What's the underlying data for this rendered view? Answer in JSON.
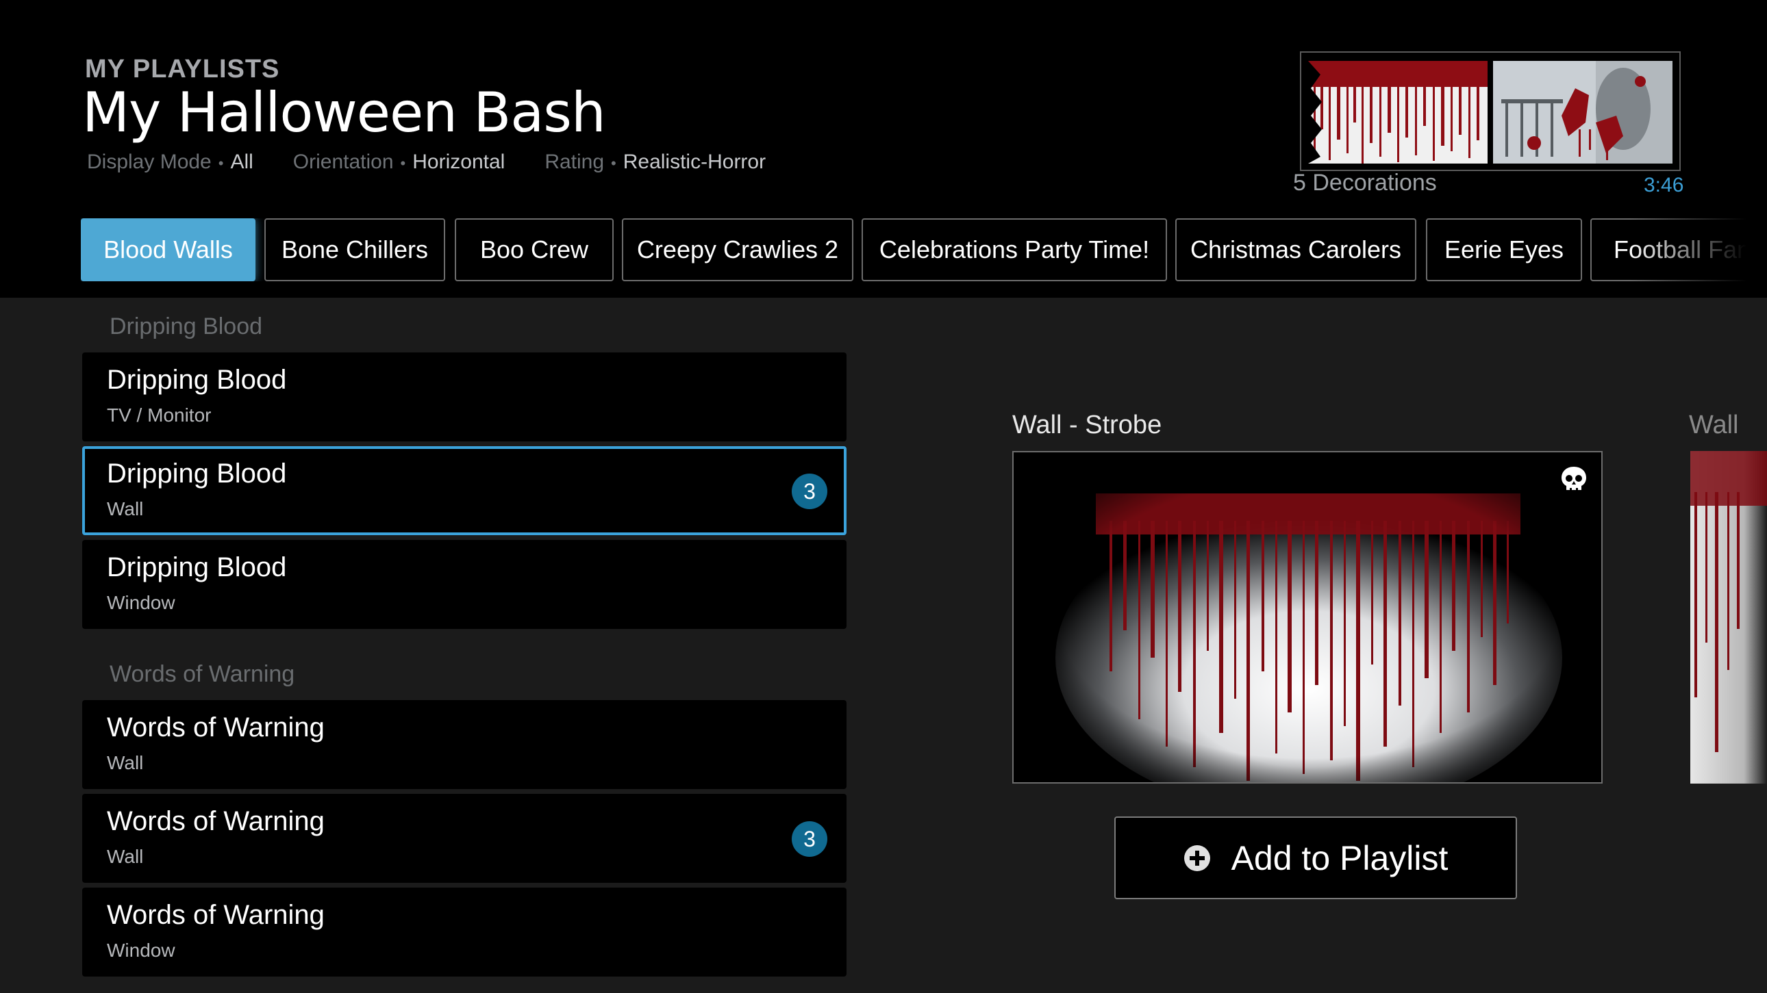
{
  "header": {
    "kicker": "MY PLAYLISTS",
    "title": "My Halloween Bash",
    "meta": [
      {
        "label": "Display Mode",
        "value": "All"
      },
      {
        "label": "Orientation",
        "value": "Horizontal"
      },
      {
        "label": "Rating",
        "value": "Realistic-Horror"
      }
    ],
    "decorations_count": "5 Decorations",
    "duration": "3:46"
  },
  "tabs": [
    {
      "label": "Blood Walls",
      "active": true
    },
    {
      "label": "Bone Chillers"
    },
    {
      "label": "Boo Crew"
    },
    {
      "label": "Creepy Crawlies 2"
    },
    {
      "label": "Celebrations Party Time!"
    },
    {
      "label": "Christmas Carolers"
    },
    {
      "label": "Eerie Eyes"
    },
    {
      "label": "Football Fanf"
    }
  ],
  "sections": [
    {
      "title": "Dripping Blood",
      "items": [
        {
          "name": "Dripping Blood",
          "sub": "TV / Monitor",
          "badge": ""
        },
        {
          "name": "Dripping Blood",
          "sub": "Wall",
          "badge": "3",
          "selected": true
        },
        {
          "name": "Dripping Blood",
          "sub": "Window",
          "badge": ""
        }
      ]
    },
    {
      "title": "Words of Warning",
      "items": [
        {
          "name": "Words of Warning",
          "sub": "Wall",
          "badge": ""
        },
        {
          "name": "Words of Warning",
          "sub": "Wall",
          "badge": "3"
        },
        {
          "name": "Words of Warning",
          "sub": "Window",
          "badge": ""
        }
      ]
    }
  ],
  "detail": {
    "label": "Wall - Strobe",
    "next_label": "Wall",
    "add_button": "Add to Playlist",
    "rating_icon": "skull-icon"
  },
  "colors": {
    "accent": "#4ea8d4",
    "selection": "#3ba3dc",
    "badge": "#106a91",
    "blood": "#8e0d14"
  }
}
